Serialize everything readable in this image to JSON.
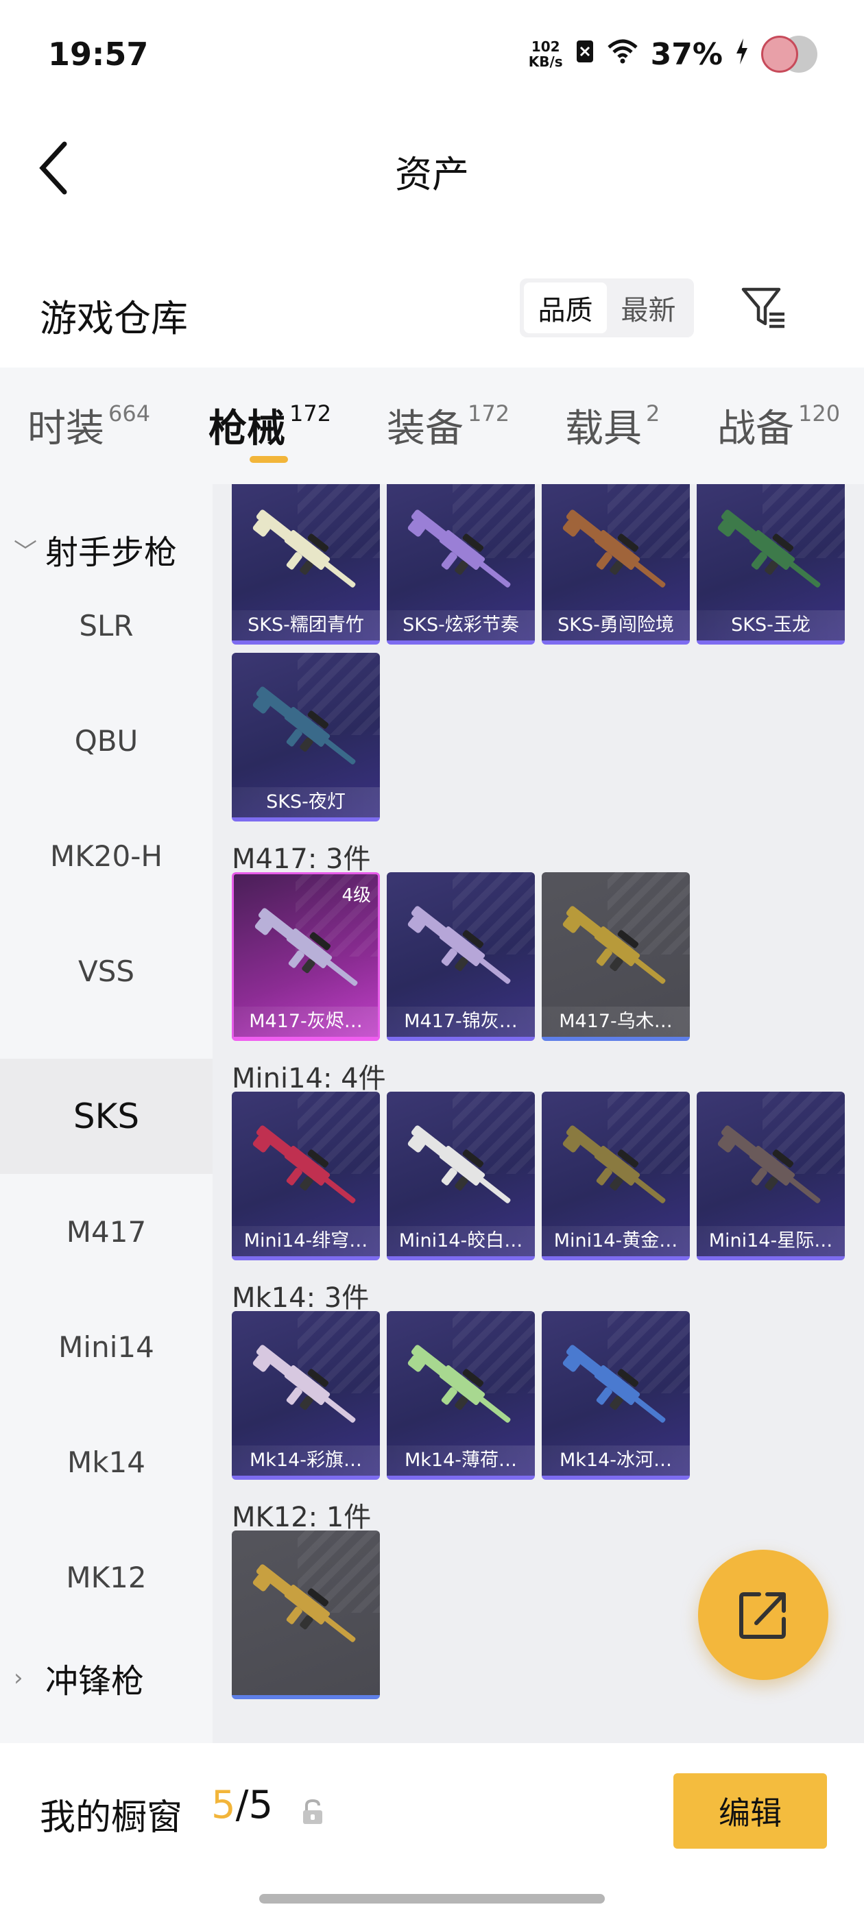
{
  "status_bar": {
    "time": "19:57",
    "net_speed_value": "102",
    "net_speed_unit": "KB/s",
    "battery": "37%",
    "icons": [
      "sim-off-icon",
      "wifi-icon",
      "charging-icon"
    ]
  },
  "header": {
    "title": "资产",
    "back_icon": "chevron-left-icon"
  },
  "warehouse": {
    "title": "游戏仓库",
    "sort_options": [
      "品质",
      "最新"
    ],
    "active_sort": "品质",
    "filter_icon": "filter-icon"
  },
  "tabs": [
    {
      "label": "时装",
      "count": "664",
      "active": false
    },
    {
      "label": "枪械",
      "count": "172",
      "active": true
    },
    {
      "label": "装备",
      "count": "172",
      "active": false
    },
    {
      "label": "载具",
      "count": "2",
      "active": false
    },
    {
      "label": "战备",
      "count": "120",
      "active": false
    }
  ],
  "sidebar": {
    "group_open": "射手步枪",
    "items": [
      "SLR",
      "QBU",
      "MK20-H",
      "VSS",
      "SKS",
      "M417",
      "Mini14",
      "Mk14",
      "MK12"
    ],
    "active_item": "SKS",
    "group_closed": "冲锋枪"
  },
  "groups": [
    {
      "label": "",
      "items": [
        {
          "name": "SKS-糯团青竹",
          "style": "purple",
          "gun_color": "#e8e6c8"
        },
        {
          "name": "SKS-炫彩节奏",
          "style": "purple",
          "gun_color": "#9a7fd6"
        },
        {
          "name": "SKS-勇闯险境",
          "style": "purple",
          "gun_color": "#a0643a"
        },
        {
          "name": "SKS-玉龙",
          "style": "purple",
          "gun_color": "#3d7a4a"
        },
        {
          "name": "SKS-夜灯",
          "style": "purple",
          "gun_color": "#3a6a8a"
        }
      ]
    },
    {
      "label": "M417: 3件",
      "items": [
        {
          "name": "M417-灰烬…",
          "style": "pink",
          "level": "4级",
          "gun_color": "#b8b0d8"
        },
        {
          "name": "M417-锦灰…",
          "style": "purple",
          "gun_color": "#b6a6d8"
        },
        {
          "name": "M417-乌木…",
          "style": "gray",
          "gun_color": "#b89a3a"
        }
      ]
    },
    {
      "label": "Mini14: 4件",
      "items": [
        {
          "name": "Mini14-绯穹…",
          "style": "purple",
          "gun_color": "#c03050"
        },
        {
          "name": "Mini14-皎白…",
          "style": "purple",
          "gun_color": "#e4e4e4"
        },
        {
          "name": "Mini14-黄金…",
          "style": "purple",
          "gun_color": "#8a7a40"
        },
        {
          "name": "Mini14-星际…",
          "style": "purple",
          "gun_color": "#6a5a5a"
        }
      ]
    },
    {
      "label": "Mk14: 3件",
      "items": [
        {
          "name": "Mk14-彩旗…",
          "style": "purple",
          "gun_color": "#d7c8e0"
        },
        {
          "name": "Mk14-薄荷…",
          "style": "purple",
          "gun_color": "#a8d890"
        },
        {
          "name": "Mk14-冰河…",
          "style": "purple",
          "gun_color": "#4a7ad0"
        }
      ]
    },
    {
      "label": "MK12: 1件",
      "items": [
        {
          "name": "",
          "style": "gray",
          "gun_color": "#c8a040"
        }
      ]
    }
  ],
  "fab": {
    "icon": "share-icon"
  },
  "showcase": {
    "label": "我的橱窗",
    "current": "5",
    "separator": "/",
    "total": "5",
    "lock_icon": "lock-icon",
    "edit_label": "编辑"
  }
}
